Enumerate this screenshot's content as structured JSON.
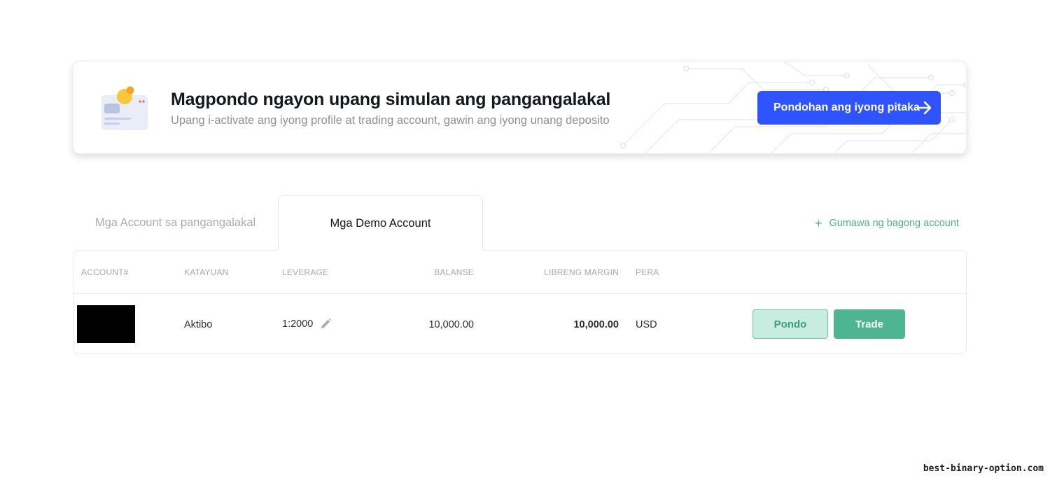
{
  "banner": {
    "title": "Magpondo ngayon upang simulan ang pangangalakal",
    "subtitle": "Upang i-activate ang iyong profile at trading account, gawin ang iyong unang deposito",
    "cta_label": "Pondohan ang iyong pitaka",
    "accent_color": "#2f53ff"
  },
  "tabs": [
    {
      "label": "Mga Account sa pangangalakal",
      "active": false
    },
    {
      "label": "Mga Demo Account",
      "active": true
    }
  ],
  "create_account_label": "Gumawa ng bagong account",
  "table": {
    "headers": {
      "account": "ACCOUNT#",
      "status": "KATAYUAN",
      "leverage": "LEVERAGE",
      "balance": "BALANSE",
      "free_margin": "LIBRENG MARGIN",
      "currency": "PERA"
    },
    "rows": [
      {
        "status": "Aktibo",
        "leverage": "1:2000",
        "balance": "10,000.00",
        "free_margin": "10,000.00",
        "currency": "USD",
        "fund_label": "Pondo",
        "trade_label": "Trade"
      }
    ]
  },
  "colors": {
    "green": "#4db592",
    "green_light": "#c9ece0"
  },
  "watermark": "best-binary-option.com"
}
